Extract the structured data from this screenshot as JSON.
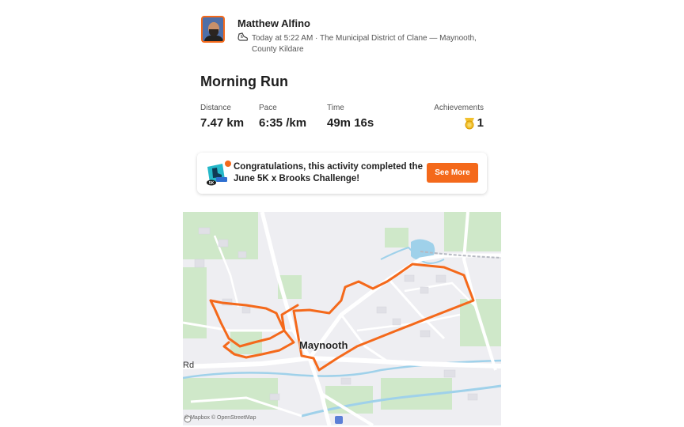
{
  "athlete": {
    "name": "Matthew Alfino",
    "meta_line1": "Today at 5:22 AM · The Municipal District of Clane — Maynooth,",
    "meta_line2": "County Kildare"
  },
  "activity": {
    "title": "Morning Run",
    "stats": [
      {
        "label": "Distance",
        "value": "7.47 km"
      },
      {
        "label": "Pace",
        "value": "6:35 /km"
      },
      {
        "label": "Time",
        "value": "49m 16s"
      }
    ],
    "achievements": {
      "label": "Achievements",
      "count": "1"
    }
  },
  "challenge": {
    "message": "Congratulations, this activity completed the June 5K x Brooks Challenge!",
    "button_label": "See More",
    "badge_text": "5K"
  },
  "map": {
    "town_label": "Maynooth",
    "road_label": "Rd",
    "attribution": "© Mapbox © OpenStreetMap",
    "route_color": "#f4691b"
  }
}
